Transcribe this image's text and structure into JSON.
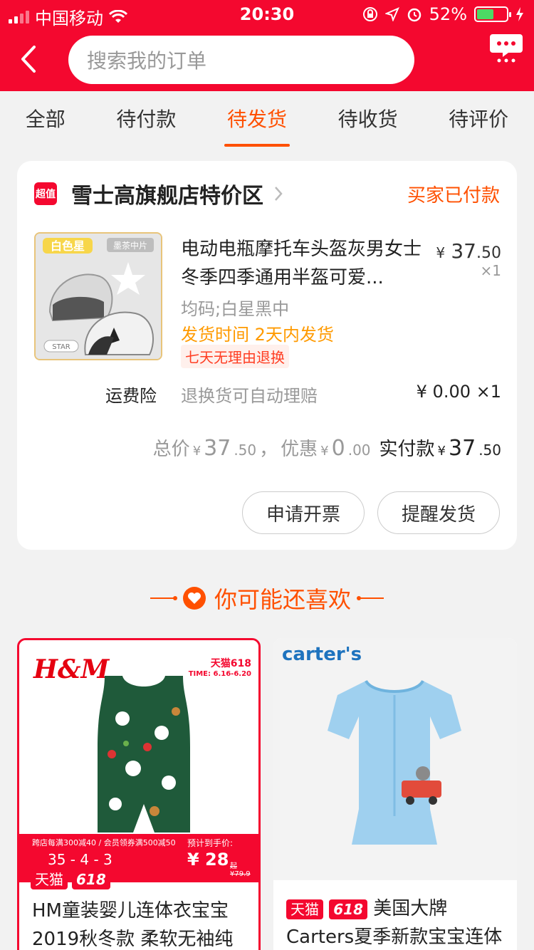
{
  "status_bar": {
    "carrier": "中国移动",
    "time": "20:30",
    "battery": "52%",
    "battery_level": 0.52
  },
  "header": {
    "search_placeholder": "搜索我的订单"
  },
  "tabs": [
    {
      "label": "全部"
    },
    {
      "label": "待付款"
    },
    {
      "label": "待发货",
      "active": true
    },
    {
      "label": "待收货"
    },
    {
      "label": "待评价"
    }
  ],
  "order": {
    "shop_badge": "超值",
    "shop_name": "雪士高旗舰店特价区",
    "status": "买家已付款",
    "product": {
      "image_text_1": "白色星",
      "image_text_2": "墨茶中片",
      "image_text_3": "STAR",
      "title": "电动电瓶摩托车头盔灰男女士冬季四季通用半盔可爱...",
      "price_currency": "¥",
      "price_main": "37",
      "price_decimal": ".50",
      "qty": "×1",
      "sku": "均码;白星黑中",
      "ship_time": "发货时间  2天内发货",
      "return_tag": "七天无理由退换"
    },
    "insurance": {
      "label": "运费险",
      "desc": "退换货可自动理赔",
      "price": "¥ 0.00 ×1"
    },
    "totals": {
      "total_label": "总价",
      "total_cur": "¥",
      "total_main": "37",
      "total_dec": ".50",
      "sep": "，",
      "discount_label": "优惠",
      "discount_cur": "¥",
      "discount_main": "0",
      "discount_dec": ".00",
      "paid_label": "实付款",
      "paid_cur": "¥",
      "paid_main": "37",
      "paid_dec": ".50"
    },
    "buttons": {
      "invoice": "申请开票",
      "remind": "提醒发货"
    }
  },
  "recommend": {
    "title": "你可能还喜欢",
    "items": [
      {
        "brand": "H&M",
        "tag_tmall": "天猫",
        "tag_618": "618",
        "badge_top": "天猫618",
        "badge_time": "TIME: 6.16-6.20",
        "promo_line": "跨店每满300减40 / 会员领券满500减50",
        "promo_vals": "35 - 4 - 3",
        "promo_price_label": "预计到手价:",
        "promo_price": "¥ 28",
        "promo_orig": "起 ¥79.9",
        "title": "HM童装婴儿连体衣宝宝2019秋冬款 柔软无袖纯"
      },
      {
        "brand": "carter's",
        "tag_tmall": "天猫",
        "tag_618": "618",
        "title": "美国大牌Carters夏季新款宝宝连体衣"
      }
    ]
  },
  "colors": {
    "brand_red": "#f4082f",
    "accent_orange": "#ff5000",
    "ship_orange": "#ff9a00"
  }
}
